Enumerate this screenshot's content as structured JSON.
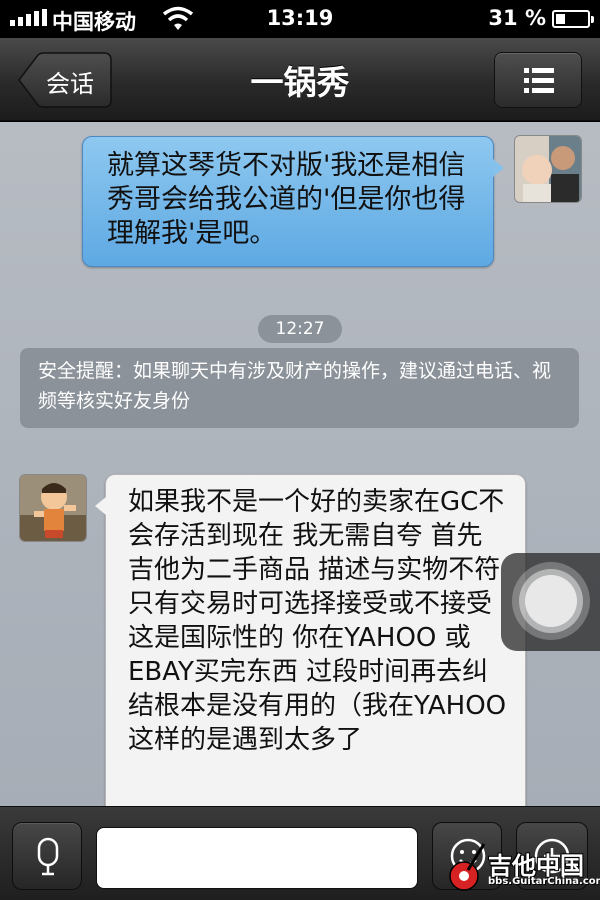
{
  "status_bar": {
    "carrier": "中国移动",
    "time": "13:19",
    "battery_percent": "31 %",
    "battery_level": 0.31,
    "signal_icon": "signal-bars-icon",
    "wifi_icon": "wifi-icon"
  },
  "nav": {
    "back_label": "会话",
    "title": "一锅秀",
    "menu_icon": "list-menu-icon"
  },
  "messages": [
    {
      "direction": "outgoing",
      "text": "就算这琴货不对版'我还是相信秀哥会给我公道的'但是你也得理解我'是吧。"
    },
    {
      "type": "timestamp",
      "text": "12:27"
    },
    {
      "type": "notice",
      "text": "安全提醒：如果聊天中有涉及财产的操作，建议通过电话、视频等核实好友身份"
    },
    {
      "direction": "incoming",
      "text": "如果我不是一个好的卖家在GC不会存活到现在 我无需自夸 首先吉他为二手商品 描述与实物不符 只有交易时可选择接受或不接受 这是国际性的 你在YAHOO 或 EBAY买完东西 过段时间再去纠结根本是没有用的（我在YAHOO这样的是遇到太多了"
    }
  ],
  "input_bar": {
    "voice_icon": "microphone-icon",
    "emoji_icon": "smiley-icon",
    "plus_icon": "plus-icon",
    "input_value": ""
  },
  "watermark": {
    "title": "吉他中国",
    "subtitle": "bbs.GuitarChina.com"
  },
  "colors": {
    "outgoing_bubble": "#6fb5e8",
    "incoming_bubble": "#f3f3f3",
    "chat_background": "#b0b6be",
    "nav_bar": "#2e2e2e"
  }
}
